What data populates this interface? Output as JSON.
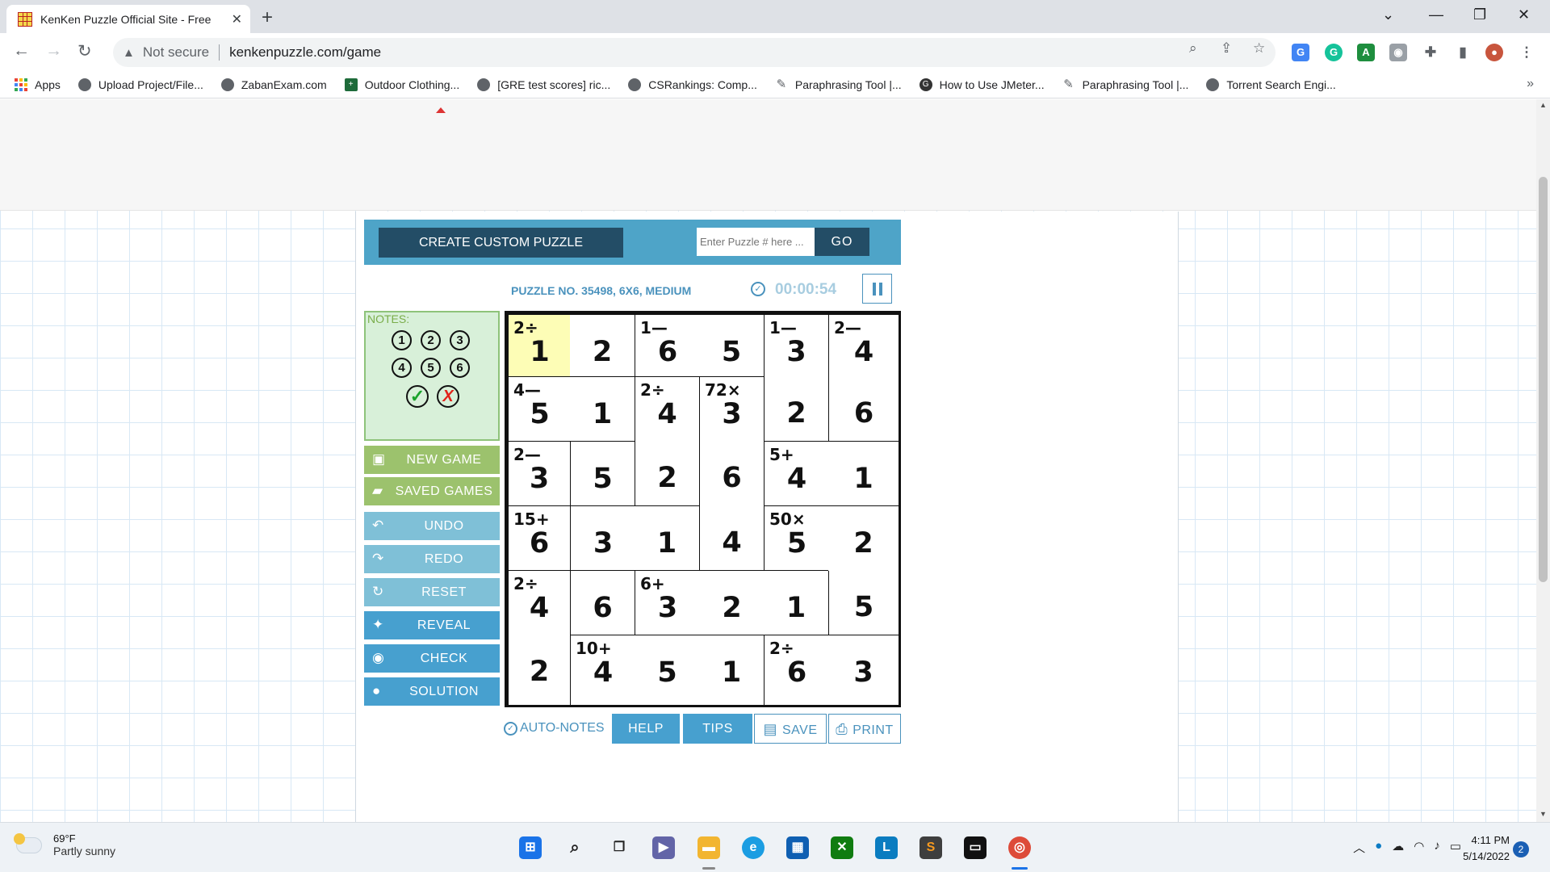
{
  "browser": {
    "tab_title": "KenKen Puzzle Official Site - Free",
    "tab_close": "✕",
    "new_tab": "+",
    "window_controls": [
      "⌄",
      "—",
      "❐",
      "✕"
    ],
    "not_secure": "Not secure",
    "url": "kenkenpuzzle.com/game",
    "bookmarks": [
      {
        "label": "Apps",
        "icon": "apps-grid-icon"
      },
      {
        "label": "Upload Project/File...",
        "icon": "globe-icon"
      },
      {
        "label": "ZabanExam.com",
        "icon": "globe-icon"
      },
      {
        "label": "Outdoor Clothing...",
        "icon": "plus-square-icon"
      },
      {
        "label": "[GRE test scores] ric...",
        "icon": "globe-icon"
      },
      {
        "label": "CSRankings: Comp...",
        "icon": "globe-icon"
      },
      {
        "label": "Paraphrasing Tool |...",
        "icon": "pen-icon"
      },
      {
        "label": "How to Use JMeter...",
        "icon": "circle-g-icon"
      },
      {
        "label": "Paraphrasing Tool |...",
        "icon": "pen-icon"
      },
      {
        "label": "Torrent Search Engi...",
        "icon": "globe-icon"
      }
    ],
    "bookmarks_more": "»"
  },
  "game": {
    "create_label": "CREATE CUSTOM PUZZLE",
    "input_placeholder": "Enter Puzzle # here ...",
    "go_label": "GO",
    "puzzle_info": "PUZZLE NO. 35498, 6X6, MEDIUM",
    "timer": "00:00:54",
    "notes_label": "NOTES:",
    "notes_numbers": [
      "1",
      "2",
      "3",
      "4",
      "5",
      "6"
    ],
    "notes_ok": "✓",
    "notes_cancel": "X",
    "buttons": {
      "new_game": "NEW GAME",
      "saved_games": "SAVED GAMES",
      "undo": "UNDO",
      "redo": "REDO",
      "reset": "RESET",
      "reveal": "REVEAL",
      "check": "CHECK",
      "solution": "SOLUTION"
    },
    "bottom": {
      "auto_notes": "AUTO-NOTES",
      "help": "HELP",
      "tips": "TIPS",
      "save": "SAVE",
      "print": "PRINT"
    },
    "grid": {
      "size": 6,
      "selected": [
        0,
        0
      ],
      "values": [
        [
          "1",
          "2",
          "6",
          "5",
          "3",
          "4"
        ],
        [
          "5",
          "1",
          "4",
          "3",
          "2",
          "6"
        ],
        [
          "3",
          "5",
          "2",
          "6",
          "4",
          "1"
        ],
        [
          "6",
          "3",
          "1",
          "4",
          "5",
          "2"
        ],
        [
          "4",
          "6",
          "3",
          "2",
          "1",
          "5"
        ],
        [
          "2",
          "4",
          "5",
          "1",
          "6",
          "3"
        ]
      ],
      "clues": [
        [
          "2÷",
          "",
          "1—",
          "",
          "1—",
          "2—"
        ],
        [
          "4—",
          "",
          "2÷",
          "72×",
          "",
          ""
        ],
        [
          "2—",
          "",
          "",
          "",
          "5+",
          ""
        ],
        [
          "15+",
          "",
          "",
          "",
          "50×",
          ""
        ],
        [
          "2÷",
          "",
          "6+",
          "",
          "",
          ""
        ],
        [
          "",
          "10+",
          "",
          "",
          "2÷",
          ""
        ]
      ],
      "cages": [
        [
          0,
          0,
          1,
          1,
          2,
          3
        ],
        [
          4,
          4,
          5,
          6,
          2,
          3
        ],
        [
          7,
          8,
          5,
          6,
          9,
          9
        ],
        [
          10,
          7,
          7,
          6,
          11,
          11
        ],
        [
          12,
          10,
          13,
          13,
          13,
          11
        ],
        [
          12,
          14,
          14,
          14,
          15,
          15
        ]
      ]
    }
  },
  "taskbar": {
    "temperature": "69°F",
    "condition": "Partly sunny",
    "time": "4:11 PM",
    "date": "5/14/2022",
    "notifications": "2"
  }
}
